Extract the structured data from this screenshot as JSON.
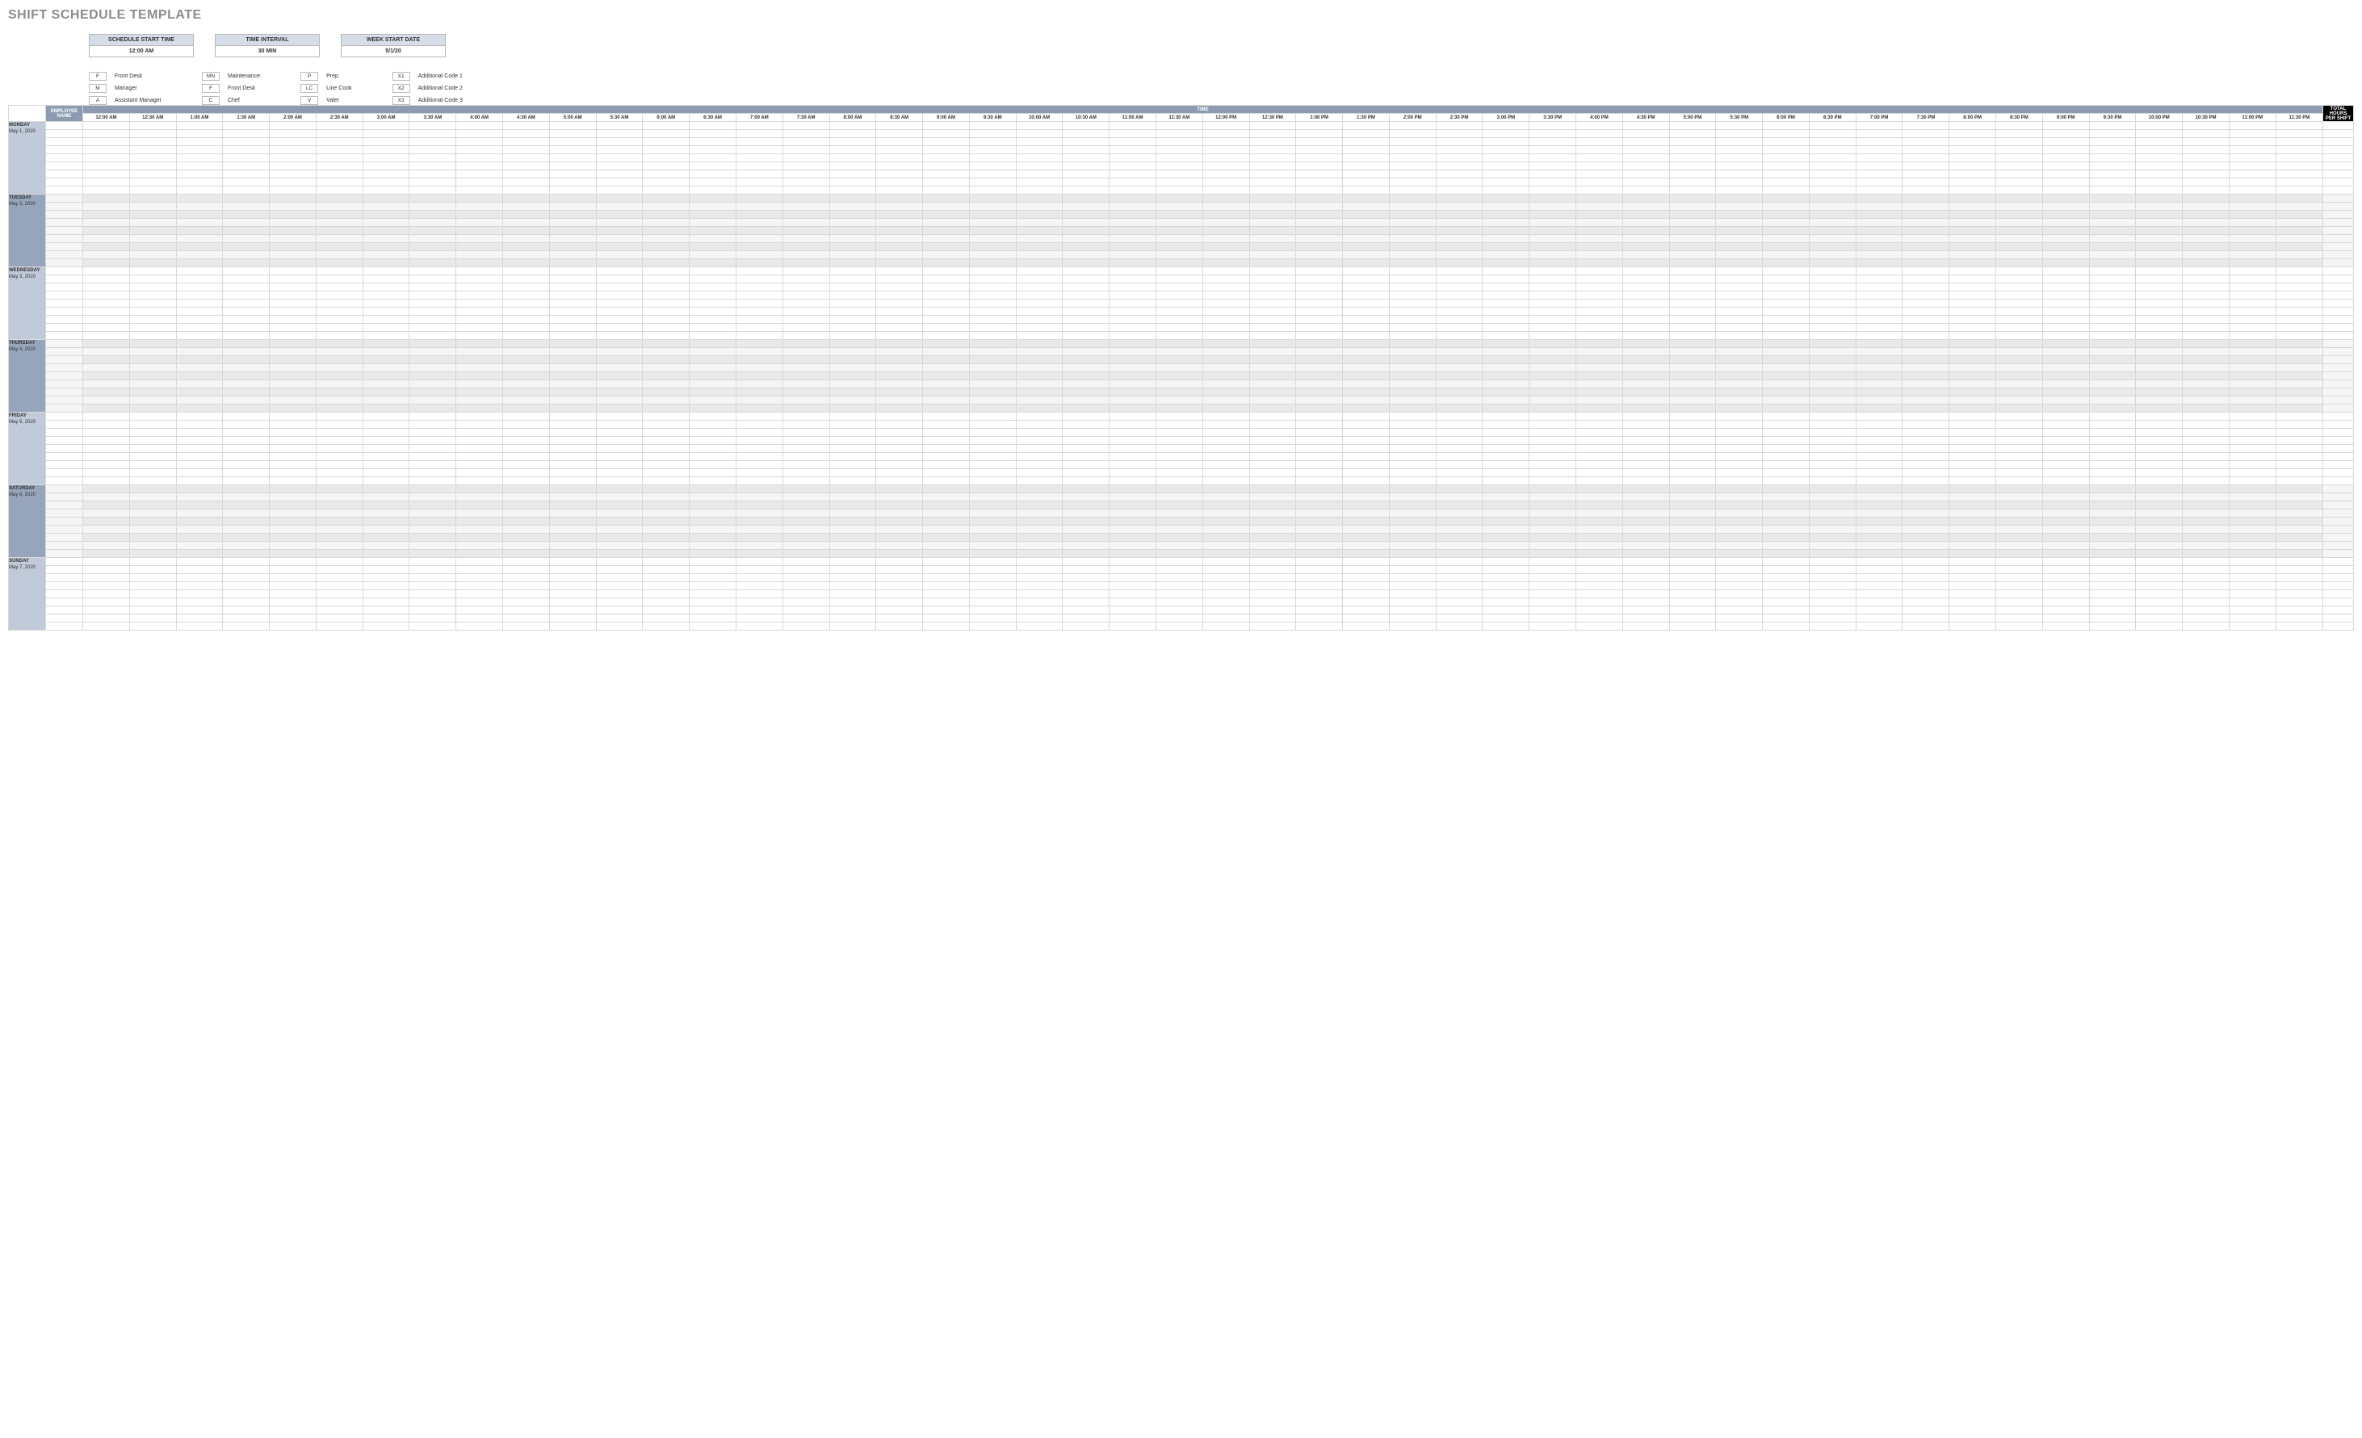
{
  "title": "SHIFT SCHEDULE TEMPLATE",
  "settings": {
    "scheduleStartTime": {
      "label": "SCHEDULE START TIME",
      "value": "12:00 AM"
    },
    "timeInterval": {
      "label": "TIME INTERVAL",
      "value": "30 MIN"
    },
    "weekStartDate": {
      "label": "WEEK START DATE",
      "value": "5/1/20"
    }
  },
  "legend": {
    "col1": [
      {
        "code": "F",
        "label": "Front Desk"
      },
      {
        "code": "M",
        "label": "Manager"
      },
      {
        "code": "A",
        "label": "Assistant Manager"
      }
    ],
    "col2": [
      {
        "code": "MN",
        "label": "Maintenance"
      },
      {
        "code": "F",
        "label": "Front Desk"
      },
      {
        "code": "C",
        "label": "Chef"
      }
    ],
    "col3": [
      {
        "code": "P",
        "label": "Prep"
      },
      {
        "code": "LC",
        "label": "Line Cook"
      },
      {
        "code": "V",
        "label": "Valet"
      }
    ],
    "col4": [
      {
        "code": "X1",
        "label": "Additional Code 1"
      },
      {
        "code": "X2",
        "label": "Additional Code 2"
      },
      {
        "code": "X3",
        "label": "Additional Code 3"
      }
    ]
  },
  "headers": {
    "employee": "EMPLOYEE NAME",
    "time": "TIME",
    "total": "TOTAL HOURS PER SHIFT"
  },
  "timeSlots": [
    "12:00 AM",
    "12:30 AM",
    "1:00 AM",
    "1:30 AM",
    "2:00 AM",
    "2:30 AM",
    "3:00 AM",
    "3:30 AM",
    "4:00 AM",
    "4:30 AM",
    "5:00 AM",
    "5:30 AM",
    "6:00 AM",
    "6:30 AM",
    "7:00 AM",
    "7:30 AM",
    "8:00 AM",
    "8:30 AM",
    "9:00 AM",
    "9:30 AM",
    "10:00 AM",
    "10:30 AM",
    "11:00 AM",
    "11:30 AM",
    "12:00 PM",
    "12:30 PM",
    "1:00 PM",
    "1:30 PM",
    "2:00 PM",
    "2:30 PM",
    "3:00 PM",
    "3:30 PM",
    "4:00 PM",
    "4:30 PM",
    "5:00 PM",
    "5:30 PM",
    "6:00 PM",
    "6:30 PM",
    "7:00 PM",
    "7:30 PM",
    "8:00 PM",
    "8:30 PM",
    "9:00 PM",
    "9:30 PM",
    "10:00 PM",
    "10:30 PM",
    "11:00 PM",
    "11:30 PM"
  ],
  "days": [
    {
      "dow": "MONDAY",
      "date": "May 1, 2020",
      "shaded": false
    },
    {
      "dow": "TUESDAY",
      "date": "May 2, 2020",
      "shaded": true
    },
    {
      "dow": "WEDNESDAY",
      "date": "May 3, 2020",
      "shaded": false
    },
    {
      "dow": "THURSDAY",
      "date": "May 4, 2020",
      "shaded": true
    },
    {
      "dow": "FRIDAY",
      "date": "May 5, 2020",
      "shaded": false
    },
    {
      "dow": "SATURDAY",
      "date": "May 6, 2020",
      "shaded": true
    },
    {
      "dow": "SUNDAY",
      "date": "May 7, 2020",
      "shaded": false
    }
  ],
  "rowsPerDay": 9
}
